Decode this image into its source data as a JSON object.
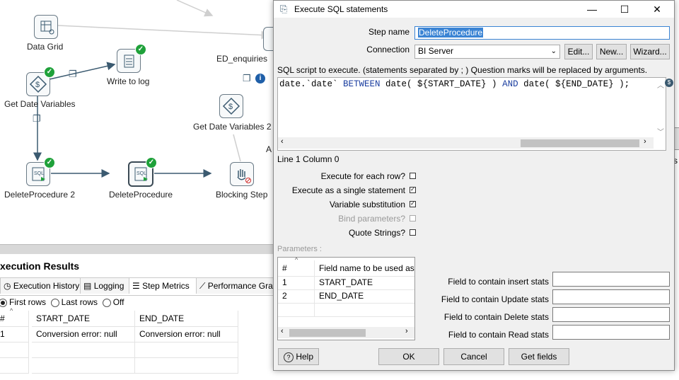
{
  "canvas": {
    "steps": [
      {
        "name": "Data Grid",
        "label": "Data Grid"
      },
      {
        "name": "Write to log",
        "label": "Write to log"
      },
      {
        "name": "Get Date Variables",
        "label": "Get Date Variables"
      },
      {
        "name": "ED_enquiries",
        "label": "ED_enquiries"
      },
      {
        "name": "Get Date Variables 2",
        "label": "Get Date Variables 2"
      },
      {
        "name": "DeleteProcedure 2",
        "label": "DeleteProcedure 2"
      },
      {
        "name": "DeleteProcedure",
        "label": "DeleteProcedure"
      },
      {
        "name": "Blocking Step",
        "label": "Blocking Step"
      }
    ],
    "partial_label": "A",
    "partial_right": "s"
  },
  "results": {
    "title": "xecution Results",
    "tabs": [
      "Execution History",
      "Logging",
      "Step Metrics",
      "Performance Gra"
    ],
    "radios": {
      "first": "First rows",
      "last": "Last rows",
      "off": "Off"
    },
    "columns": [
      "#",
      "START_DATE",
      "END_DATE"
    ],
    "rows": [
      {
        "num": "1",
        "start": "Conversion error: null",
        "end": "Conversion error: null"
      }
    ]
  },
  "dialog": {
    "title": "Execute SQL statements",
    "step_name_label": "Step name",
    "step_name_value": "DeleteProcedure",
    "connection_label": "Connection",
    "connection_value": "BI Server",
    "edit_btn": "Edit...",
    "new_btn": "New...",
    "wizard_btn": "Wizard...",
    "sql_hint": "SQL script to execute. (statements separated by ; ) Question marks will be replaced by arguments.",
    "sql_parts": {
      "p1": "date.`date` ",
      "p2": "BETWEEN",
      "p3": " date( ${START_DATE} ) ",
      "p4": "AND",
      "p5": " date( ${END_DATE} );"
    },
    "position": "Line 1 Column 0",
    "options": {
      "each_row": "Execute for each row?",
      "single": "Execute as a single statement",
      "varsub": "Variable substitution",
      "bind": "Bind parameters?",
      "quote": "Quote Strings?"
    },
    "params_label": "Parameters :",
    "param_columns": [
      "#",
      "Field name to be used as"
    ],
    "params": [
      {
        "num": "1",
        "field": "START_DATE"
      },
      {
        "num": "2",
        "field": "END_DATE"
      }
    ],
    "stats": {
      "insert": "Field to contain insert stats",
      "update": "Field to contain Update stats",
      "delete": "Field to contain Delete stats",
      "read": "Field to contain Read stats"
    },
    "buttons": {
      "help": "Help",
      "ok": "OK",
      "cancel": "Cancel",
      "get_fields": "Get fields"
    }
  }
}
